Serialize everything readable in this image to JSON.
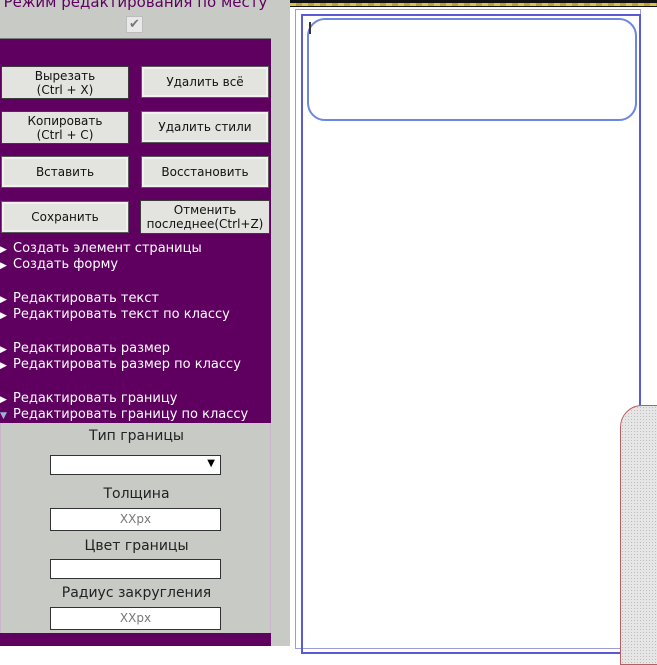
{
  "panel": {
    "title": "Режим редактирования по месту",
    "checkbox_mark": "✔",
    "buttons": {
      "cut": "Вырезать\n(Ctrl + X)",
      "delete_all": "Удалить всё",
      "copy": "Копировать\n(Ctrl + C)",
      "delete_styles": "Удалить стили",
      "paste": "Вставить",
      "restore": "Восстановить",
      "save": "Сохранить",
      "undo": "Отменить\nпоследнее(Ctrl+Z)"
    },
    "menu": [
      {
        "label": "Создать элемент страницы",
        "expanded": false
      },
      {
        "label": "Создать форму",
        "expanded": false
      },
      {
        "label": "Редактировать текст",
        "expanded": false
      },
      {
        "label": "Редактировать текст по классу",
        "expanded": false
      },
      {
        "label": "Редактировать размер",
        "expanded": false
      },
      {
        "label": "Редактировать размер по классу",
        "expanded": false
      },
      {
        "label": "Редактировать границу",
        "expanded": false
      },
      {
        "label": "Редактировать границу по классу",
        "expanded": true
      }
    ],
    "arrow_collapsed": "▶",
    "arrow_expanded": "▼",
    "border_panel": {
      "type_label": "Тип границы",
      "type_value": "",
      "width_label": "Толщина",
      "width_placeholder": "XXpx",
      "color_label": "Цвет границы",
      "color_value": "",
      "radius_label": "Радиус закругления",
      "radius_placeholder": "XXpx"
    }
  },
  "colors": {
    "panel_bg": "#5f0060",
    "grey_bg": "#c8cac6",
    "frame_blue": "#5a5ad8"
  }
}
